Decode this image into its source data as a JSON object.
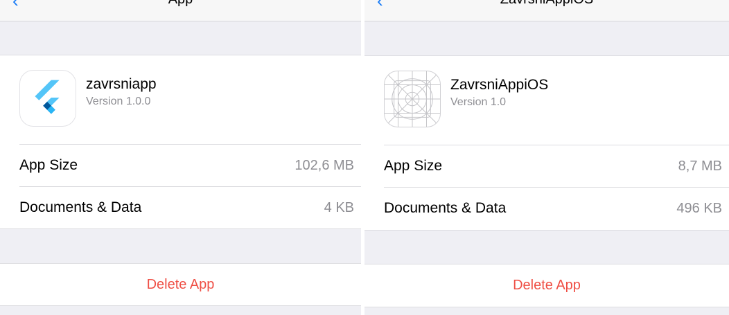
{
  "left_panel": {
    "nav": {
      "back_icon": "chevron-left-icon",
      "title": "App"
    },
    "app": {
      "name": "zavrsniapp",
      "version": "Version 1.0.0",
      "icon": "flutter-logo-icon"
    },
    "rows": [
      {
        "label": "App Size",
        "value": "102,6 MB"
      },
      {
        "label": "Documents & Data",
        "value": "4 KB"
      }
    ],
    "delete_label": "Delete App"
  },
  "right_panel": {
    "nav": {
      "back_icon": "chevron-left-icon",
      "title": "ZavrsniAppiOS"
    },
    "app": {
      "name": "ZavrsniAppiOS",
      "version": "Version 1.0",
      "icon": "app-icon-placeholder-grid"
    },
    "rows": [
      {
        "label": "App Size",
        "value": "8,7 MB"
      },
      {
        "label": "Documents & Data",
        "value": "496 KB"
      }
    ],
    "delete_label": "Delete App"
  },
  "colors": {
    "background": "#efeff4",
    "delete": "#ef4f45",
    "secondary_text": "#8e8e93",
    "tint": "#1a7cf6"
  }
}
